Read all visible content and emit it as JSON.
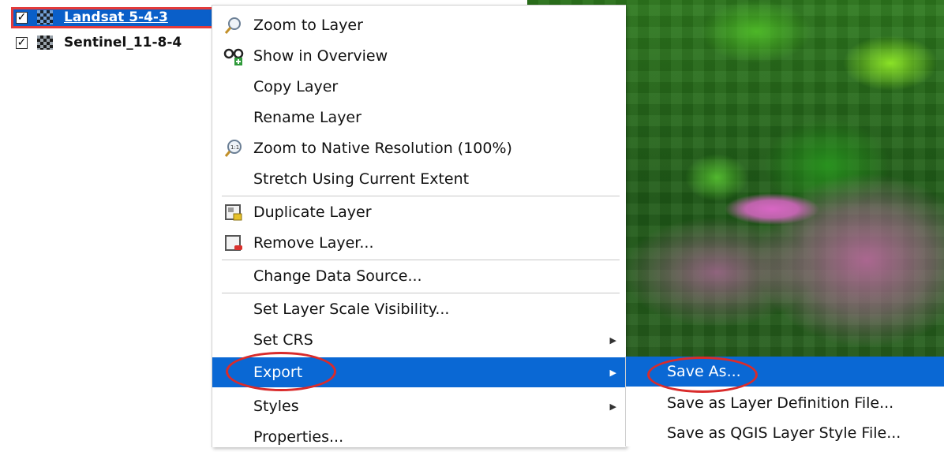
{
  "layers": [
    {
      "name": "Landsat 5-4-3",
      "checked": true,
      "selected": true,
      "icon": "raster-layer-icon"
    },
    {
      "name": "Sentinel_11-8-4",
      "checked": true,
      "selected": false,
      "icon": "raster-layer-icon"
    }
  ],
  "checkmark": "✓",
  "context_menu": {
    "items": [
      {
        "label": "Zoom to Layer",
        "icon": "zoom-to-layer-icon"
      },
      {
        "label": "Show in Overview",
        "icon": "show-in-overview-icon"
      },
      {
        "label": "Copy Layer"
      },
      {
        "label": "Rename Layer"
      },
      {
        "label": "Zoom to Native Resolution (100%)",
        "icon": "zoom-native-resolution-icon"
      },
      {
        "label": "Stretch Using Current Extent"
      },
      {
        "label": "Duplicate Layer",
        "icon": "duplicate-layer-icon"
      },
      {
        "label": "Remove Layer...",
        "icon": "remove-layer-icon"
      },
      {
        "label": "Change Data Source..."
      },
      {
        "label": "Set Layer Scale Visibility..."
      },
      {
        "label": "Set CRS",
        "submenu": true
      },
      {
        "label": "Export",
        "submenu": true,
        "highlighted": true
      },
      {
        "label": "Styles",
        "submenu": true
      },
      {
        "label": "Properties..."
      }
    ]
  },
  "export_submenu": {
    "items": [
      {
        "label": "Save As...",
        "highlighted": true
      },
      {
        "label": "Save as Layer Definition File..."
      },
      {
        "label": "Save as QGIS Layer Style File..."
      }
    ]
  },
  "submenu_arrow": "▶",
  "colors": {
    "highlight": "#0a68d4",
    "annotation": "#d92b2b"
  }
}
